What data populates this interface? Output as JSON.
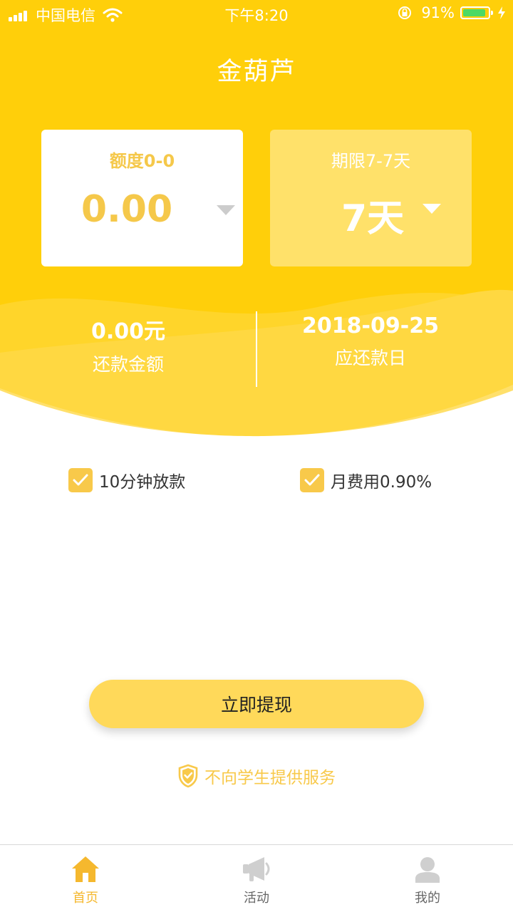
{
  "status_bar": {
    "carrier": "中国电信",
    "time": "下午8:20",
    "battery_percent": "91%",
    "battery_level": 0.91
  },
  "header": {
    "title": "金葫芦"
  },
  "amount_card": {
    "label": "额度0-0",
    "value": "0.00"
  },
  "term_card": {
    "label": "期限7-7天",
    "value": "7天"
  },
  "summary": {
    "repay_amount_value": "0.00元",
    "repay_amount_label": "还款金额",
    "due_date_value": "2018-09-25",
    "due_date_label": "应还款日"
  },
  "features": [
    {
      "label": "10分钟放款",
      "checked": true
    },
    {
      "label": "月费用0.90%",
      "checked": true
    }
  ],
  "cta": {
    "label": "立即提现"
  },
  "notice": {
    "text": "不向学生提供服务"
  },
  "tabs": [
    {
      "label": "首页",
      "icon": "home-icon",
      "active": true
    },
    {
      "label": "活动",
      "icon": "megaphone-icon",
      "active": false
    },
    {
      "label": "我的",
      "icon": "user-icon",
      "active": false
    }
  ],
  "colors": {
    "brand_yellow": "#FFCF0A",
    "accent_gold": "#F5C84A",
    "button_yellow": "#FFD95A",
    "tab_active": "#F5B82E",
    "battery_green": "#4CD964"
  }
}
